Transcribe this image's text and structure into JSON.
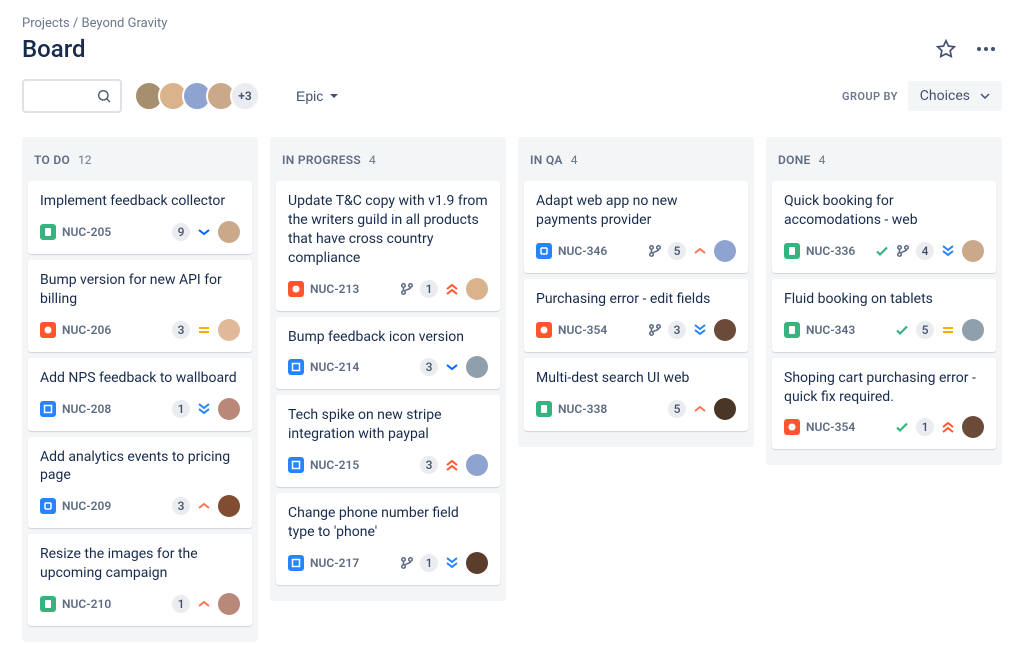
{
  "breadcrumb": {
    "parent": "Projects",
    "project": "Beyond Gravity"
  },
  "page_title": "Board",
  "groupby": {
    "label": "GROUP BY",
    "value": "Choices"
  },
  "epic_label": "Epic",
  "avatars_more": "+3",
  "avatar_colors": [
    "#a58f6e",
    "#d9b38c",
    "#8fa3d1",
    "#caa98a"
  ],
  "columns": [
    {
      "title": "TO DO",
      "count": 12,
      "cards": [
        {
          "title": "Implement feedback collector",
          "type": "story",
          "type_color": "#36B37E",
          "key": "NUC-205",
          "count": 9,
          "priority": "low",
          "avatar_color": "#caa98a"
        },
        {
          "title": "Bump version for new API for billing",
          "type": "bug",
          "type_color": "#FF5630",
          "key": "NUC-206",
          "count": 3,
          "priority": "medium",
          "avatar_color": "#e0b99a"
        },
        {
          "title": "Add NPS feedback to wallboard",
          "type": "task",
          "type_color": "#2684FF",
          "key": "NUC-208",
          "count": 1,
          "priority": "lowest",
          "avatar_color": "#b98878"
        },
        {
          "title": "Add analytics events to pricing page",
          "type": "change",
          "type_color": "#2684FF",
          "key": "NUC-209",
          "count": 3,
          "priority": "high",
          "avatar_color": "#804d33"
        },
        {
          "title": "Resize the images for the upcoming campaign",
          "type": "story",
          "type_color": "#36B37E",
          "key": "NUC-210",
          "count": 1,
          "priority": "high",
          "avatar_color": "#b98878"
        }
      ]
    },
    {
      "title": "IN PROGRESS",
      "count": 4,
      "cards": [
        {
          "title": "Update T&C copy with v1.9 from the writers guild in all products that have cross country compliance",
          "type": "bug",
          "type_color": "#FF5630",
          "key": "NUC-213",
          "branch": true,
          "count": 1,
          "priority": "highest",
          "avatar_color": "#d9b38c"
        },
        {
          "title": "Bump feedback icon version",
          "type": "task",
          "type_color": "#2684FF",
          "key": "NUC-214",
          "count": 3,
          "priority": "low",
          "avatar_color": "#8f9fac"
        },
        {
          "title": "Tech spike on new stripe integration with paypal",
          "type": "task",
          "type_color": "#2684FF",
          "key": "NUC-215",
          "count": 3,
          "priority": "highest",
          "avatar_color": "#8fa3d1"
        },
        {
          "title": "Change phone number field type to 'phone'",
          "type": "task",
          "type_color": "#2684FF",
          "key": "NUC-217",
          "branch": true,
          "count": 1,
          "priority": "lowest",
          "avatar_color": "#5a3e2b"
        }
      ]
    },
    {
      "title": "IN QA",
      "count": 4,
      "cards": [
        {
          "title": "Adapt web app no new payments provider",
          "type": "change",
          "type_color": "#2684FF",
          "key": "NUC-346",
          "branch": true,
          "count": 5,
          "priority": "high",
          "avatar_color": "#8fa3d1"
        },
        {
          "title": "Purchasing error - edit fields",
          "type": "bug",
          "type_color": "#FF5630",
          "key": "NUC-354",
          "branch": true,
          "count": 3,
          "priority": "lowest",
          "avatar_color": "#6b4a3a"
        },
        {
          "title": "Multi-dest search UI web",
          "type": "story",
          "type_color": "#36B37E",
          "key": "NUC-338",
          "count": 5,
          "priority": "high",
          "avatar_color": "#4a3626"
        }
      ]
    },
    {
      "title": "DONE",
      "count": 4,
      "cards": [
        {
          "title": "Quick booking for accomodations - web",
          "type": "story",
          "type_color": "#36B37E",
          "key": "NUC-336",
          "done": true,
          "branch": true,
          "count": 4,
          "priority": "lowest",
          "avatar_color": "#caa98a"
        },
        {
          "title": "Fluid booking on tablets",
          "type": "story",
          "type_color": "#36B37E",
          "key": "NUC-343",
          "done": true,
          "count": 5,
          "priority": "medium",
          "avatar_color": "#8f9fac"
        },
        {
          "title": "Shoping cart purchasing error - quick fix required.",
          "type": "bug",
          "type_color": "#FF5630",
          "key": "NUC-354",
          "done": true,
          "count": 1,
          "priority": "highest",
          "avatar_color": "#6b4a3a"
        }
      ]
    }
  ]
}
